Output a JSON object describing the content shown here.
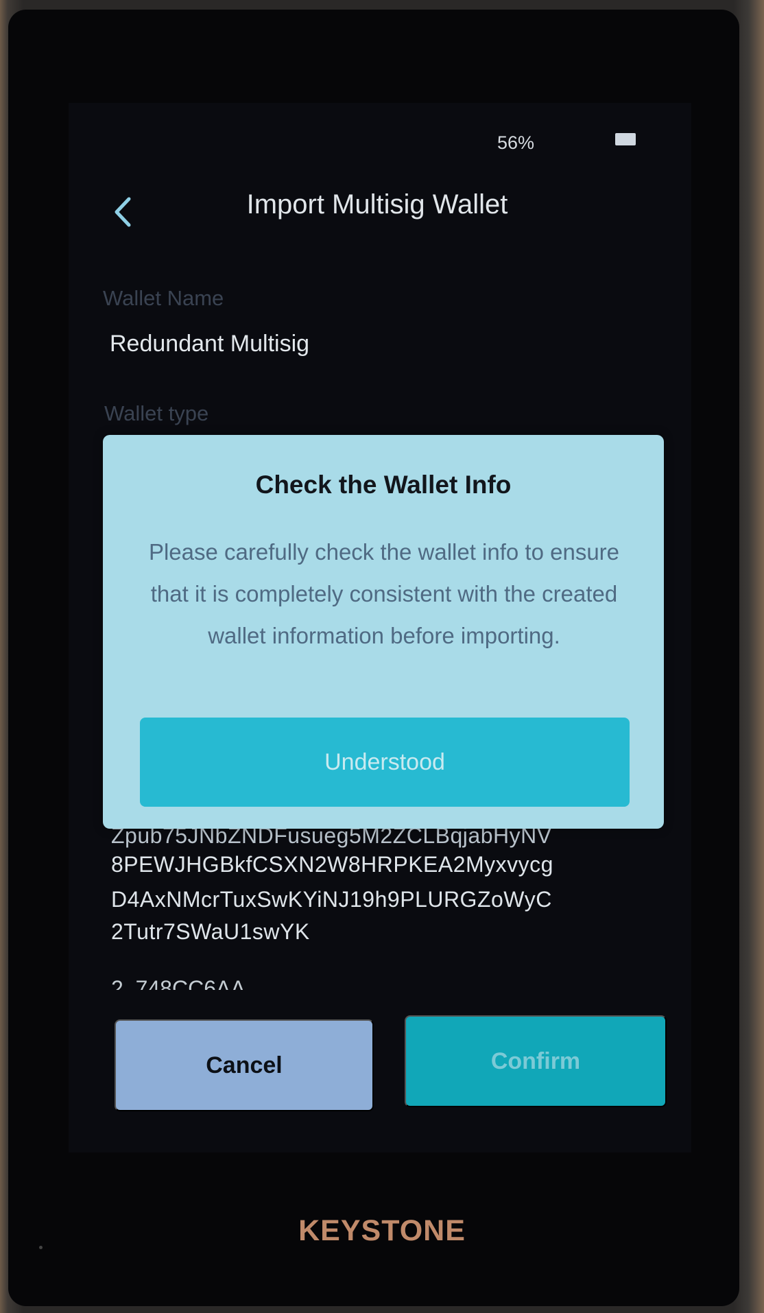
{
  "status_bar": {
    "battery_percent": "56%",
    "battery_icon": "battery-icon"
  },
  "header": {
    "back_icon": "chevron-left-icon",
    "title": "Import Multisig Wallet"
  },
  "form": {
    "wallet_name_label": "Wallet Name",
    "wallet_name_value": "Redundant Multisig",
    "wallet_type_label": "Wallet type"
  },
  "xpub": {
    "line_1_partial": "Zpub75JNbZNDFusueg5M2ZCLBqjabHyNV",
    "line_2": "8PEWJHGBkfCSXN2W8HRPKEA2Myxvycg",
    "line_3": "D4AxNMcrTuxSwKYiNJ19h9PLURGZoWyC",
    "line_4": "2Tutr7SWaU1swYK"
  },
  "fingerprint_partial": "2. 748CC6AA",
  "modal": {
    "title": "Check the Wallet Info",
    "message": "Please carefully check the wallet info to ensure that it is completely consistent with the created wallet information before importing.",
    "button_label": "Understood"
  },
  "actions": {
    "cancel_label": "Cancel",
    "confirm_label": "Confirm"
  },
  "brand": "KEYSTONE",
  "colors": {
    "accent": "#27bad2",
    "modal_bg": "#a9dbe8",
    "cancel_bg": "#8eaed7",
    "screen_bg": "#0a0b10"
  }
}
